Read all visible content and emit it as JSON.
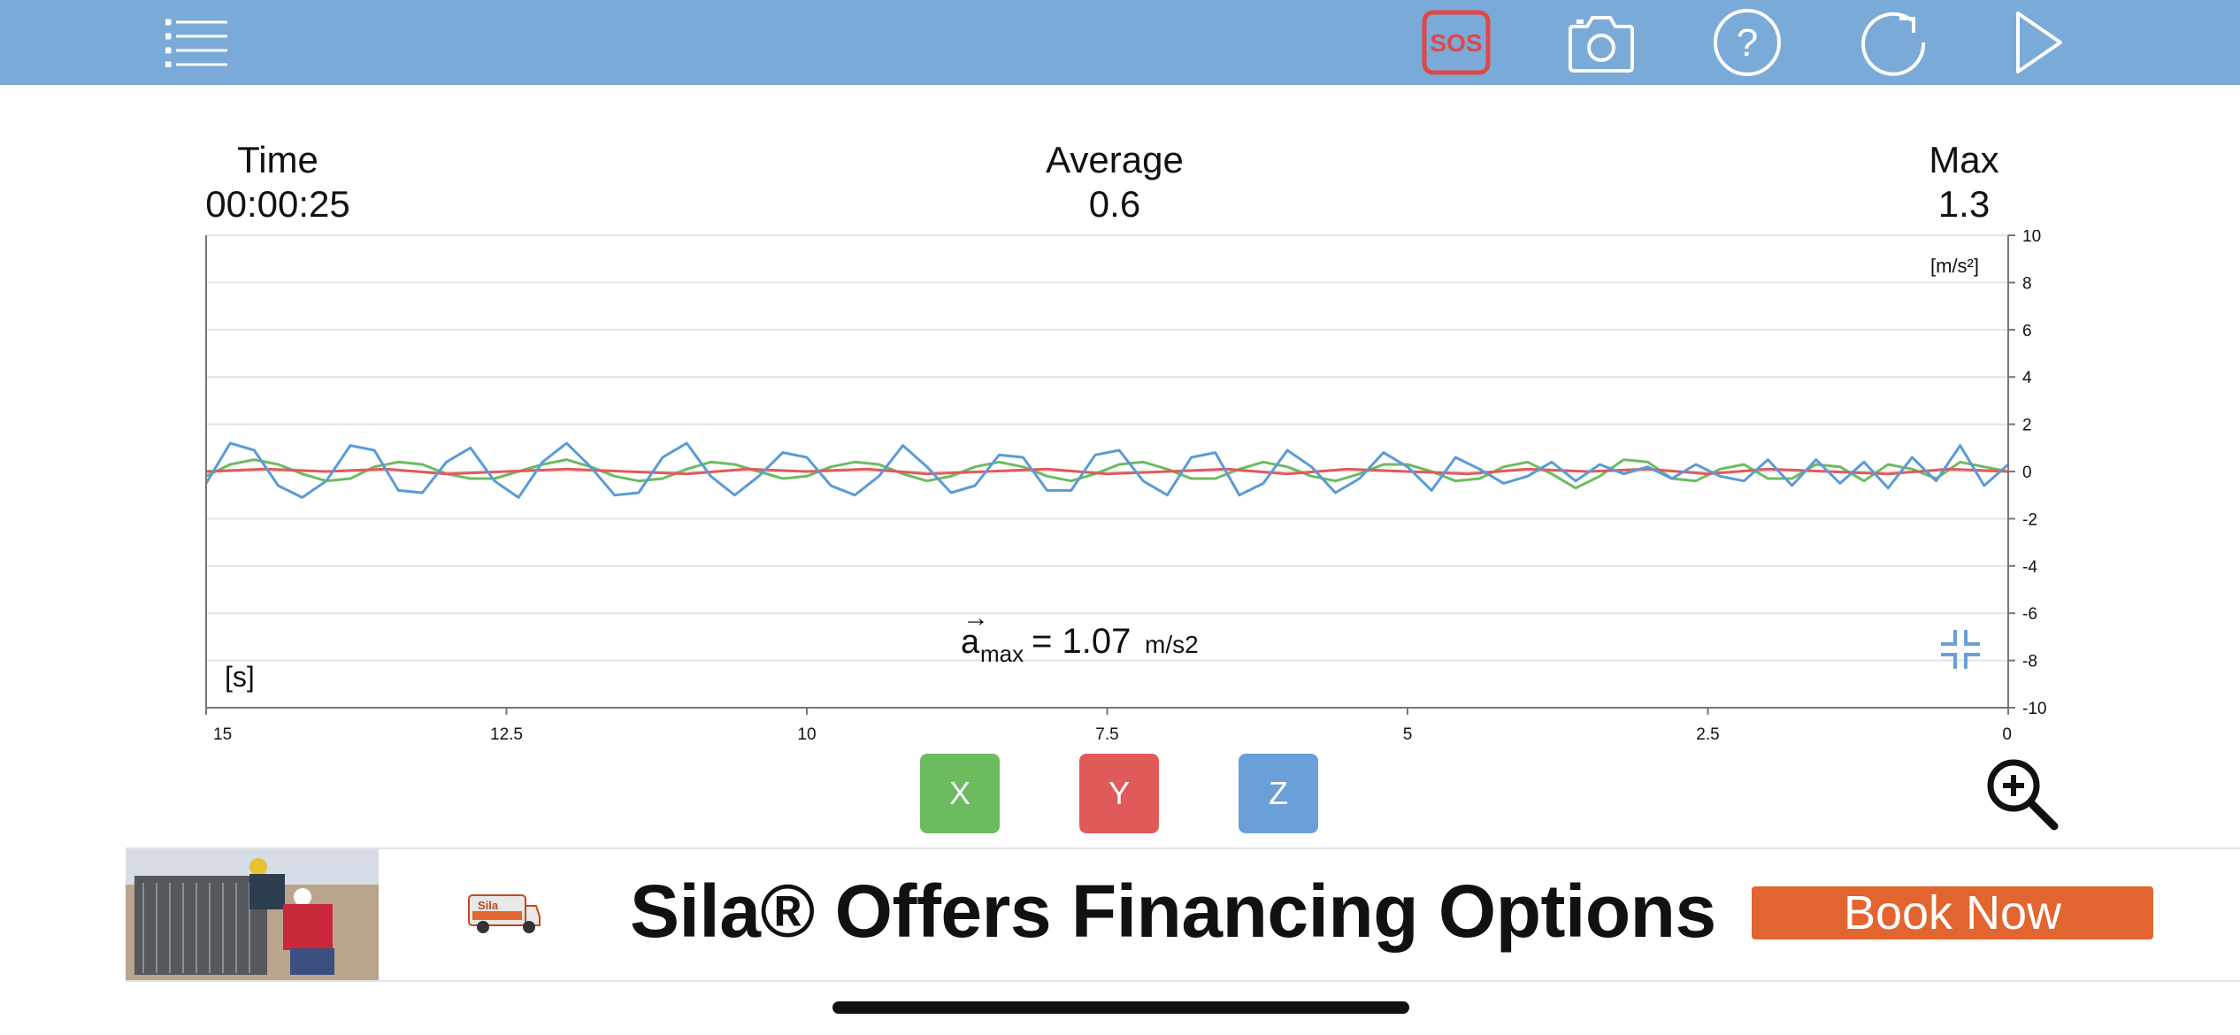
{
  "toolbar": {
    "icons": [
      "list-menu-icon",
      "sos-icon",
      "camera-icon",
      "help-icon",
      "refresh-icon",
      "play-icon"
    ],
    "sos_label": "SOS",
    "help_label": "?"
  },
  "stats": {
    "time_label": "Time",
    "time_value": "00:00:25",
    "average_label": "Average",
    "average_value": "0.6",
    "max_label": "Max",
    "max_value": "1.3"
  },
  "chart_data": {
    "type": "line",
    "unit_label": "[m/s²]",
    "xlabel": "[s]",
    "xlim": [
      15,
      0
    ],
    "ylim": [
      -10,
      10
    ],
    "x_ticks": [
      "15",
      "12.5",
      "10",
      "7.5",
      "5",
      "2.5",
      "0"
    ],
    "y_ticks": [
      "10",
      "8",
      "6",
      "4",
      "2",
      "0",
      "-2",
      "-4",
      "-6",
      "-8",
      "-10"
    ],
    "grid": true,
    "annotation": {
      "symbol": "a",
      "subscript": "max",
      "value_text": "= 1.07",
      "unit": "m/s2"
    },
    "series": [
      {
        "axis": "X",
        "color": "#6cbb5f",
        "x": [
          15,
          14.8,
          14.6,
          14.4,
          14.2,
          14,
          13.8,
          13.6,
          13.4,
          13.2,
          13,
          12.8,
          12.6,
          12.4,
          12.2,
          12,
          11.8,
          11.6,
          11.4,
          11.2,
          11,
          10.8,
          10.6,
          10.4,
          10.2,
          10,
          9.8,
          9.6,
          9.4,
          9.2,
          9,
          8.8,
          8.6,
          8.4,
          8.2,
          8,
          7.8,
          7.6,
          7.4,
          7.2,
          7,
          6.8,
          6.6,
          6.4,
          6.2,
          6,
          5.8,
          5.6,
          5.4,
          5.2,
          5,
          4.8,
          4.6,
          4.4,
          4.2,
          4,
          3.8,
          3.6,
          3.4,
          3.2,
          3,
          2.8,
          2.6,
          2.4,
          2.2,
          2,
          1.8,
          1.6,
          1.4,
          1.2,
          1,
          0.8,
          0.6,
          0.4,
          0.2,
          0
        ],
        "y": [
          -0.2,
          0.3,
          0.5,
          0.3,
          -0.1,
          -0.4,
          -0.3,
          0.2,
          0.4,
          0.3,
          -0.1,
          -0.3,
          -0.3,
          0,
          0.3,
          0.5,
          0.2,
          -0.2,
          -0.4,
          -0.3,
          0.1,
          0.4,
          0.3,
          0,
          -0.3,
          -0.2,
          0.2,
          0.4,
          0.3,
          -0.1,
          -0.4,
          -0.2,
          0.2,
          0.4,
          0.2,
          -0.2,
          -0.4,
          -0.1,
          0.3,
          0.4,
          0.1,
          -0.3,
          -0.3,
          0.1,
          0.4,
          0.2,
          -0.2,
          -0.4,
          -0.1,
          0.3,
          0.3,
          0,
          -0.4,
          -0.3,
          0.2,
          0.4,
          -0.1,
          -0.7,
          -0.2,
          0.5,
          0.4,
          -0.3,
          -0.4,
          0.1,
          0.3,
          -0.3,
          -0.3,
          0.3,
          0.2,
          -0.4,
          0.3,
          0.1,
          -0.3,
          0.4,
          0.2,
          0
        ]
      },
      {
        "axis": "Y",
        "color": "#e05a5a",
        "x": [
          15,
          14.5,
          14,
          13.5,
          13,
          12.5,
          12,
          11.5,
          11,
          10.5,
          10,
          9.5,
          9,
          8.5,
          8,
          7.5,
          7,
          6.5,
          6,
          5.5,
          5,
          4.5,
          4,
          3.5,
          3,
          2.5,
          2,
          1.5,
          1,
          0.5,
          0
        ],
        "y": [
          0,
          0.1,
          0,
          0.1,
          -0.1,
          0,
          0.1,
          0,
          -0.1,
          0.1,
          0,
          0.1,
          -0.1,
          0,
          0.1,
          -0.1,
          0,
          0.1,
          -0.1,
          0.1,
          0,
          -0.1,
          0.1,
          0,
          0.1,
          -0.1,
          0.1,
          0,
          -0.1,
          0.1,
          0
        ]
      },
      {
        "axis": "Z",
        "color": "#5b9bd5",
        "x": [
          15,
          14.8,
          14.6,
          14.4,
          14.2,
          14,
          13.8,
          13.6,
          13.4,
          13.2,
          13,
          12.8,
          12.6,
          12.4,
          12.2,
          12,
          11.8,
          11.6,
          11.4,
          11.2,
          11,
          10.8,
          10.6,
          10.4,
          10.2,
          10,
          9.8,
          9.6,
          9.4,
          9.2,
          9,
          8.8,
          8.6,
          8.4,
          8.2,
          8,
          7.8,
          7.6,
          7.4,
          7.2,
          7,
          6.8,
          6.6,
          6.4,
          6.2,
          6,
          5.8,
          5.6,
          5.4,
          5.2,
          5,
          4.8,
          4.6,
          4.4,
          4.2,
          4,
          3.8,
          3.6,
          3.4,
          3.2,
          3,
          2.8,
          2.6,
          2.4,
          2.2,
          2,
          1.8,
          1.6,
          1.4,
          1.2,
          1,
          0.8,
          0.6,
          0.4,
          0.2,
          0
        ],
        "y": [
          -0.5,
          1.2,
          0.9,
          -0.6,
          -1.1,
          -0.4,
          1.1,
          0.9,
          -0.8,
          -0.9,
          0.4,
          1.0,
          -0.4,
          -1.1,
          0.4,
          1.2,
          0.2,
          -1.0,
          -0.9,
          0.6,
          1.2,
          -0.2,
          -1.0,
          -0.2,
          0.8,
          0.6,
          -0.6,
          -1.0,
          -0.2,
          1.1,
          0.2,
          -0.9,
          -0.6,
          0.7,
          0.6,
          -0.8,
          -0.8,
          0.7,
          0.9,
          -0.4,
          -1.0,
          0.6,
          0.8,
          -1.0,
          -0.5,
          0.9,
          0.2,
          -0.9,
          -0.3,
          0.8,
          0.2,
          -0.8,
          0.6,
          0.1,
          -0.5,
          -0.2,
          0.4,
          -0.4,
          0.3,
          -0.1,
          0.2,
          -0.3,
          0.3,
          -0.2,
          -0.4,
          0.5,
          -0.6,
          0.5,
          -0.5,
          0.4,
          -0.7,
          0.6,
          -0.4,
          1.1,
          -0.6,
          0.3
        ]
      }
    ]
  },
  "axis_buttons": {
    "x": "X",
    "y": "Y",
    "z": "Z"
  },
  "colors": {
    "topbar": "#7aaad8",
    "x_button": "#6cbb5f",
    "y_button": "#e05a5a",
    "z_button": "#6a9fd8",
    "sos": "#e04848",
    "ad_cta": "#e2652f"
  },
  "ad": {
    "headline": "Sila® Offers Financing Options",
    "cta": "Book Now",
    "van_text": "Sila"
  }
}
